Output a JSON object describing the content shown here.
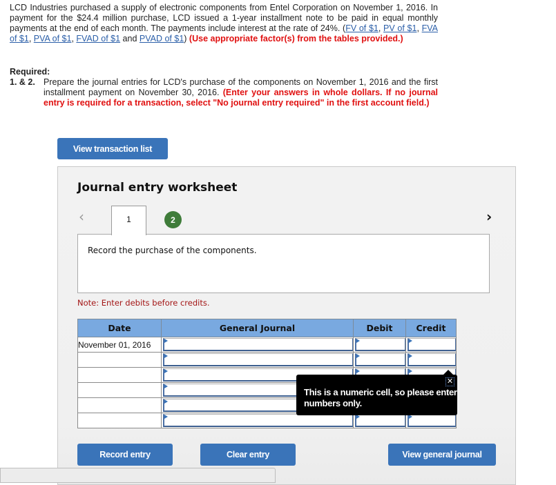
{
  "intro": {
    "p1": "LCD Industries purchased a supply of electronic components from Entel Corporation on November 1, 2016. In payment for the $24.4 million purchase, LCD issued a 1-year installment note to be paid in equal monthly payments at the end of each month. The payments include interest at the rate of 24%. (",
    "links": [
      "FV of $1",
      "PV of $1",
      "FVA of $1",
      "PVA of $1",
      "FVAD of $1",
      "PVAD of $1"
    ],
    "sep_comma": ", ",
    "sep_and": " and ",
    "close_paren": ") ",
    "instruction": "(Use appropriate factor(s) from the tables provided.)"
  },
  "required": {
    "title": "Required:",
    "number": "1. & 2.",
    "text": "Prepare the journal entries for LCD's purchase of the components on November 1, 2016 and the first installment payment on November 30, 2016. ",
    "instruction": "(Enter your answers in whole dollars. If no journal entry is required for a transaction, select \"No journal entry required\" in the first account field.)"
  },
  "buttons": {
    "view_transaction_list": "View transaction list",
    "record_entry": "Record entry",
    "clear_entry": "Clear entry",
    "view_general_journal": "View general journal"
  },
  "worksheet": {
    "title": "Journal entry worksheet",
    "prev_icon": "‹",
    "next_icon": "›",
    "tabs": [
      "1",
      "2"
    ],
    "active_tab": "1",
    "description": "Record the purchase of the components.",
    "note": "Note: Enter debits before credits.",
    "table": {
      "headers": [
        "Date",
        "General Journal",
        "Debit",
        "Credit"
      ],
      "rows": [
        {
          "date": "November 01, 2016",
          "account": "",
          "debit": "",
          "credit": ""
        },
        {
          "date": "",
          "account": "",
          "debit": "",
          "credit": ""
        },
        {
          "date": "",
          "account": "",
          "debit": "",
          "credit": ""
        },
        {
          "date": "",
          "account": "",
          "debit": "",
          "credit": ""
        },
        {
          "date": "",
          "account": "",
          "debit": "",
          "credit": ""
        },
        {
          "date": "",
          "account": "",
          "debit": "",
          "credit": ""
        }
      ]
    }
  },
  "tooltip": {
    "text": "This is a numeric cell, so please enter numbers only.",
    "close_icon": "✕"
  },
  "colors": {
    "button_blue": "#3a74b9",
    "header_blue": "#79a9e0",
    "instruction_red": "#e01010",
    "note_red": "#a31515",
    "tab_green": "#3f7c3a",
    "link_blue": "#2a5ea8"
  }
}
